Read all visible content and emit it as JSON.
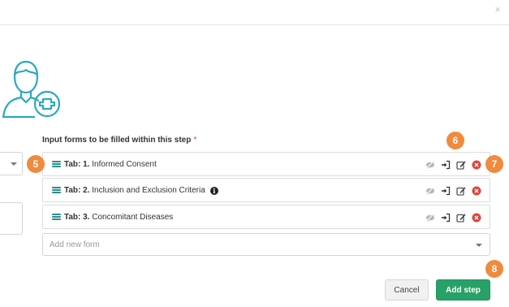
{
  "modal": {
    "close_glyph": "×",
    "section_label": "Input forms to be filled within this step",
    "required_mark": "*"
  },
  "forms": [
    {
      "prefix": "Tab: 1.",
      "title": "Informed Consent",
      "has_info": false
    },
    {
      "prefix": "Tab: 2.",
      "title": "Inclusion and Exclusion Criteria",
      "has_info": true
    },
    {
      "prefix": "Tab: 3.",
      "title": "Concomitant Diseases",
      "has_info": false
    }
  ],
  "info_glyph": "i",
  "row_actions": [
    "eye-slash-icon",
    "sign-in-icon",
    "edit-icon",
    "remove-icon"
  ],
  "add_form": {
    "placeholder": "Add new form"
  },
  "buttons": {
    "cancel": "Cancel",
    "add_step": "Add step"
  },
  "badges": {
    "b5": "5",
    "b6": "6",
    "b7": "7",
    "b8": "8"
  },
  "colors": {
    "accent_teal": "#2a8c8c",
    "avatar_teal": "#2aa9c0",
    "badge_orange": "#f08a3c",
    "primary_green": "#27a167",
    "remove_red": "#e0443b"
  }
}
